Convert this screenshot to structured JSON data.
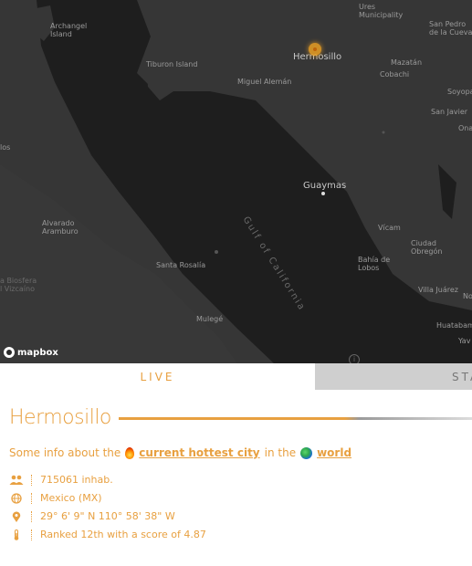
{
  "map": {
    "attribution": "mapbox",
    "info_glyph": "i",
    "places": {
      "archangel": "Archangel\nIsland",
      "ures": "Ures\nMunicipality",
      "san_pedro": "San Pedro\nde la Cueva",
      "tiburon": "Tiburon Island",
      "hermosillo": "Hermosillo",
      "mazatan": "Mazatán",
      "miguel_aleman": "Miguel Alemán",
      "cobachi": "Cobachi",
      "soyopa": "Soyopa",
      "san_javier": "San Javier",
      "onavas": "Onav",
      "guaymas": "Guaymas",
      "los": "los",
      "alvarado": "Alvarado\nAramburo",
      "gulf": "Gulf of California",
      "vicam": "Vícam",
      "ciudad_obregon": "Ciudad\nObregón",
      "santa_rosalia": "Santa Rosalía",
      "bahia_lobos": "Bahía de\nLobos",
      "biosphere": "a Biosfera\nl Vizcaíno",
      "villa_juarez": "Villa Juárez",
      "mulege": "Mulegé",
      "huatabampo": "Huatabampo",
      "no": "No",
      "yav": "Yav"
    }
  },
  "tabs": {
    "live": "LIVE",
    "stats": "STATS"
  },
  "city": {
    "name": "Hermosillo",
    "heat_fraction": 0.64
  },
  "intro": {
    "prefix": "Some info about the",
    "hottest_link": "current hottest city",
    "middle": "in the",
    "world_link": "world"
  },
  "stats": {
    "population": "715061 inhab.",
    "country": "Mexico (MX)",
    "coordinates": "29° 6' 9\" N 110° 58' 38\" W",
    "rank": "Ranked 12th with a score of 4.87"
  },
  "colors": {
    "accent": "#e8a040",
    "map_bg": "#2a2a2a",
    "land": "#3a3a3a",
    "water": "#202020"
  }
}
